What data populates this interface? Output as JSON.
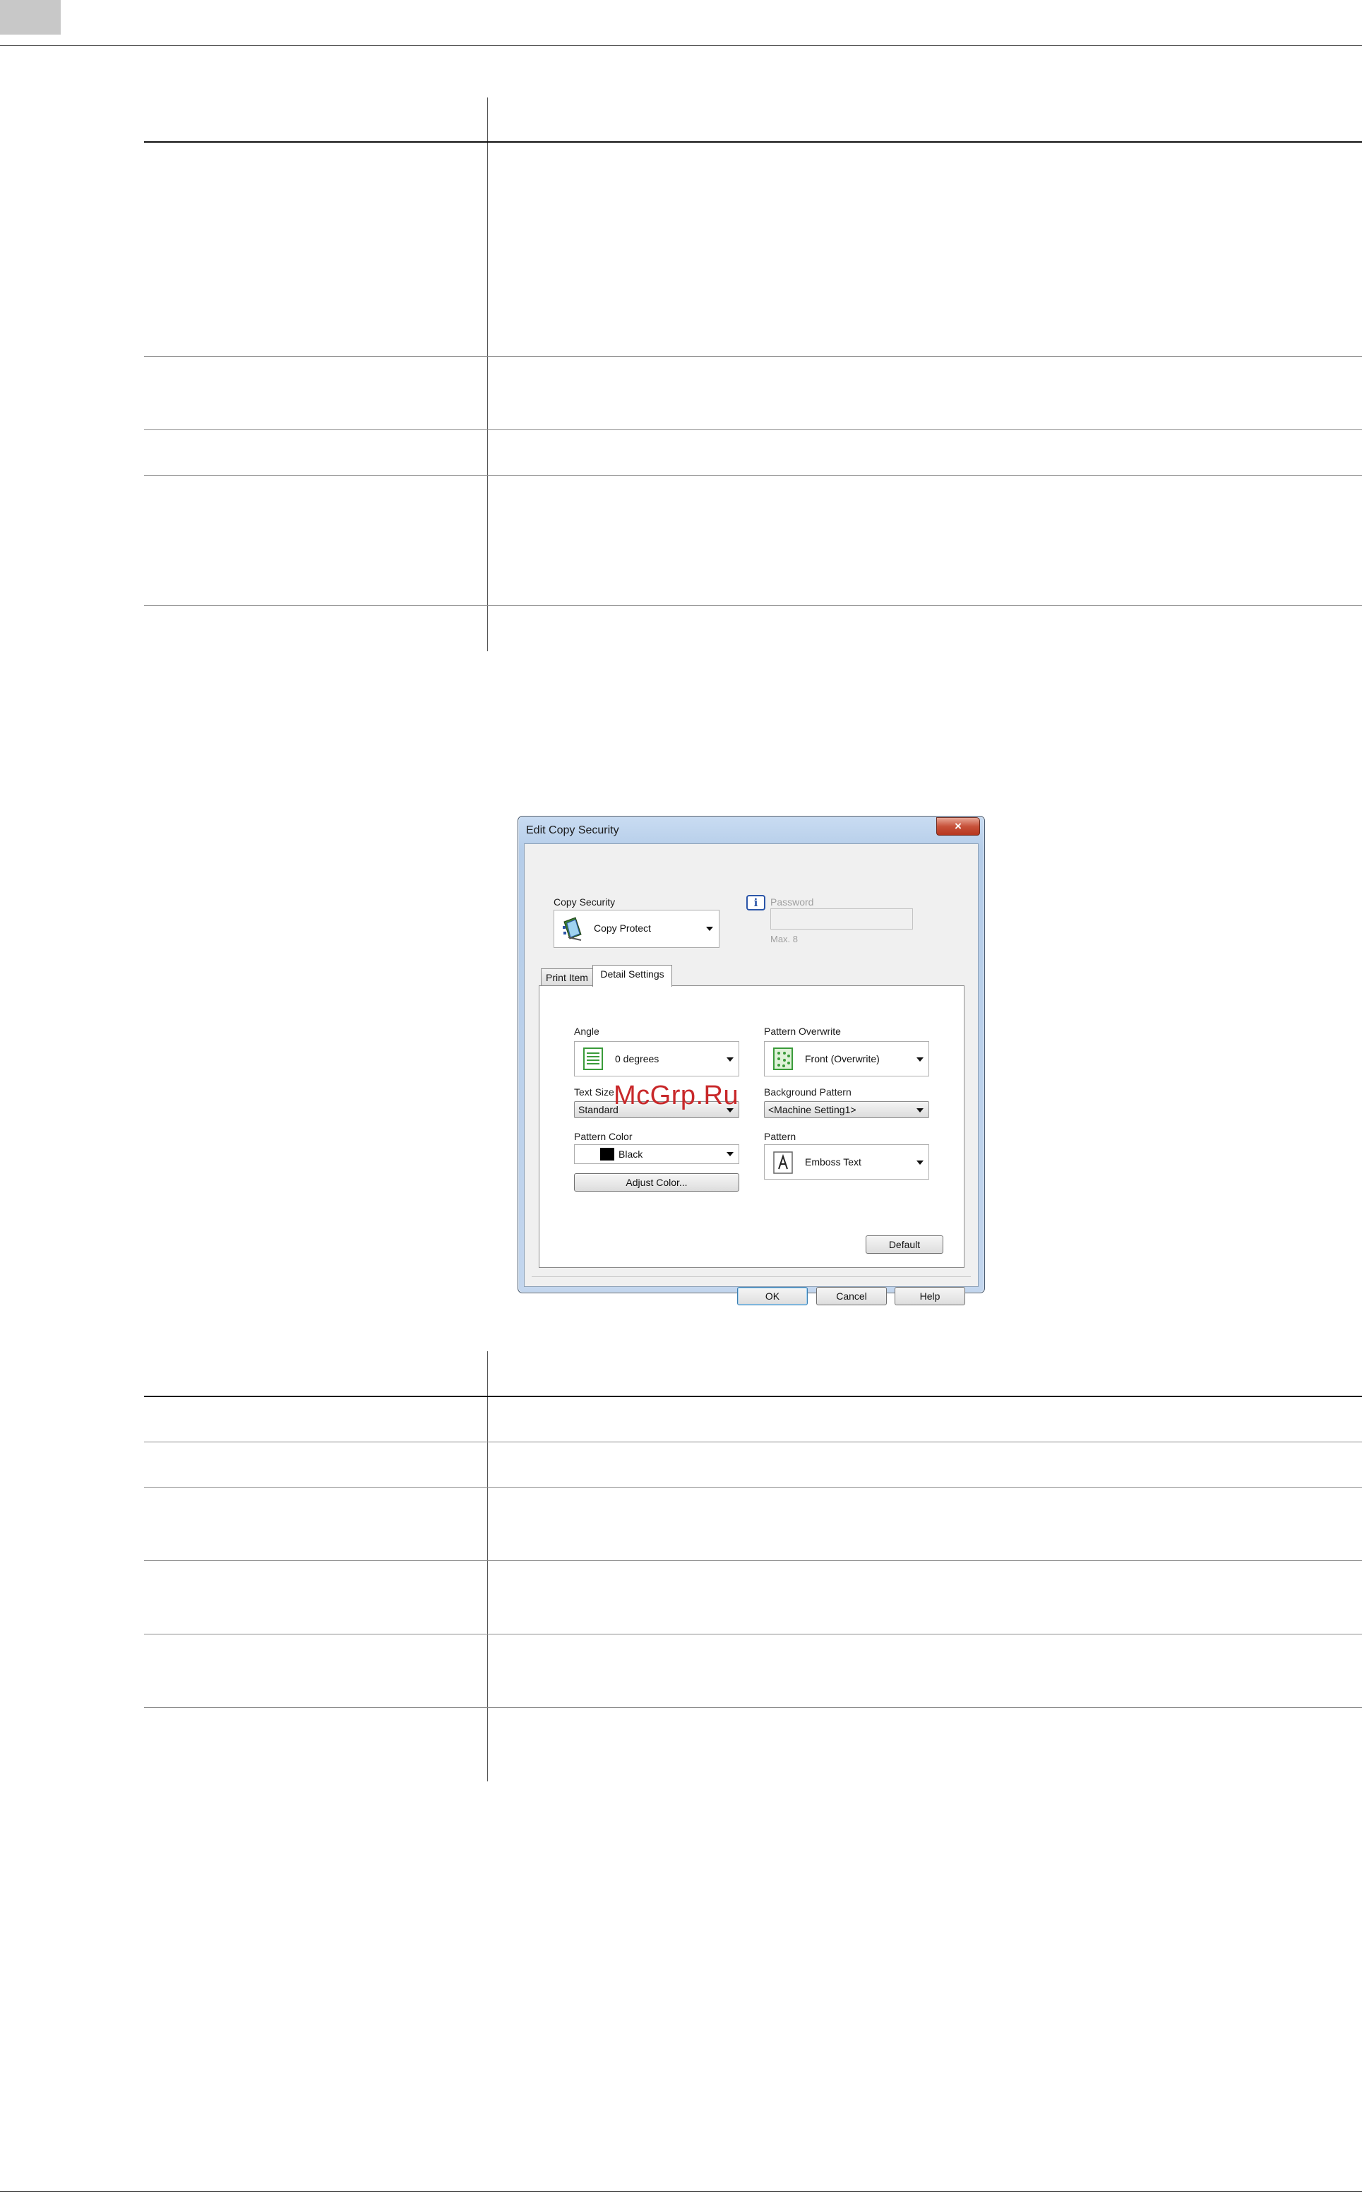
{
  "dialog": {
    "title": "Edit Copy Security",
    "close_glyph": "×",
    "copy_security": {
      "label": "Copy Security",
      "value": "Copy Protect",
      "icon": "copy-protect-icon"
    },
    "password": {
      "label": "Password",
      "hint": "Max. 8",
      "value": ""
    },
    "info_glyph": "i",
    "tabs": [
      {
        "label": "Print Item",
        "active": false
      },
      {
        "label": "Detail Settings",
        "active": true
      }
    ],
    "detail": {
      "angle": {
        "label": "Angle",
        "value": "0 degrees"
      },
      "text_size": {
        "label": "Text Size",
        "value": "Standard"
      },
      "pattern_color": {
        "label": "Pattern Color",
        "value": "Black",
        "swatch": "#000000"
      },
      "adjust_color_button": "Adjust Color...",
      "pattern_overwrite": {
        "label": "Pattern Overwrite",
        "value": "Front (Overwrite)"
      },
      "background_pattern": {
        "label": "Background Pattern",
        "value": "<Machine Setting1>"
      },
      "pattern": {
        "label": "Pattern",
        "value": "Emboss Text"
      },
      "default_button": "Default"
    },
    "buttons": {
      "ok": "OK",
      "cancel": "Cancel",
      "help": "Help"
    }
  },
  "watermark": "McGrp.Ru",
  "colors": {
    "accent_title_bar": "#b5cde9",
    "close_button": "#c7513a",
    "watermark": "#c8282a"
  }
}
